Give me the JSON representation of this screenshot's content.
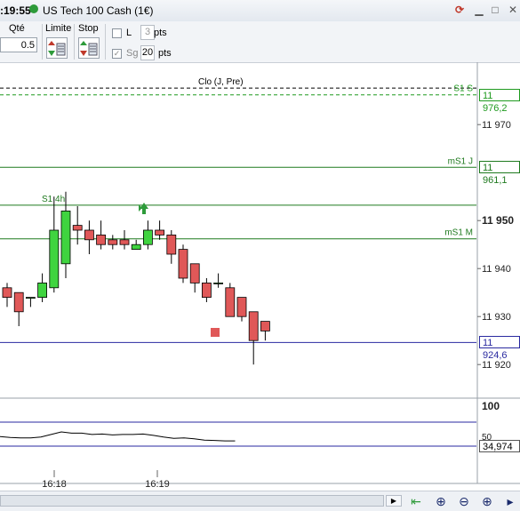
{
  "window": {
    "clock": ":19:55",
    "title": "US Tech 100 Cash (1€)"
  },
  "toolbar": {
    "qty_label": "Qté",
    "qty_value": "0.5",
    "limit_label": "Limite",
    "stop_label": "Stop",
    "l_label": "L",
    "l_value": "3",
    "l_unit": "pts",
    "sg_label": "Sg",
    "sg_value": "20",
    "sg_unit": "pts"
  },
  "chart": {
    "levels": [
      {
        "name": "Clo (J, Pre)",
        "price": 11977.6,
        "tag": "",
        "color": "#000000",
        "dash": true
      },
      {
        "name": "S1 S",
        "price": 11976.2,
        "tag": "11 976,2",
        "color": "#1f9a1f",
        "dash": true
      },
      {
        "name": "mS1 J",
        "price": 11961.1,
        "tag": "11 961,1",
        "color": "#1f7a1f",
        "dash": false
      },
      {
        "name": "S1 4h",
        "price": 11953.2,
        "tag": "",
        "color": "#1f7a1f",
        "dash": false
      },
      {
        "name": "mS1 M",
        "price": 11946.2,
        "tag": "",
        "color": "#1f7a1f",
        "dash": false
      },
      {
        "name": "",
        "price": 11924.6,
        "tag": "11 924,6",
        "color": "#2a2aa0",
        "dash": false
      }
    ],
    "y_ticks": [
      {
        "label": "11 970",
        "price": 11970,
        "bold": false
      },
      {
        "label": "11 950",
        "price": 11950,
        "bold": true
      },
      {
        "label": "11 940",
        "price": 11940,
        "bold": false
      },
      {
        "label": "11 930",
        "price": 11930,
        "bold": false
      },
      {
        "label": "11 920",
        "price": 11920,
        "bold": false
      }
    ],
    "x_ticks": [
      "16:18",
      "16:19"
    ],
    "indicator": {
      "top_label": "100",
      "mid_label": "50",
      "value_tag": "34,974"
    }
  },
  "chart_data": {
    "type": "candlestick",
    "ylim": [
      11913,
      11983
    ],
    "candles": [
      {
        "o": 11936,
        "h": 11937,
        "l": 11932,
        "c": 11934
      },
      {
        "o": 11935,
        "h": 11935,
        "l": 11928,
        "c": 11931
      },
      {
        "o": 11934,
        "h": 11934,
        "l": 11932,
        "c": 11934
      },
      {
        "o": 11934,
        "h": 11939,
        "l": 11933,
        "c": 11937
      },
      {
        "o": 11936,
        "h": 11955,
        "l": 11935,
        "c": 11948
      },
      {
        "o": 11941,
        "h": 11956,
        "l": 11938,
        "c": 11952
      },
      {
        "o": 11949,
        "h": 11953,
        "l": 11945,
        "c": 11948
      },
      {
        "o": 11948,
        "h": 11950,
        "l": 11943,
        "c": 11946
      },
      {
        "o": 11947,
        "h": 11950,
        "l": 11944,
        "c": 11945
      },
      {
        "o": 11946,
        "h": 11947,
        "l": 11944,
        "c": 11945
      },
      {
        "o": 11946,
        "h": 11948,
        "l": 11944,
        "c": 11945
      },
      {
        "o": 11944,
        "h": 11946,
        "l": 11944,
        "c": 11945
      },
      {
        "o": 11945,
        "h": 11950,
        "l": 11944,
        "c": 11948
      },
      {
        "o": 11948,
        "h": 11950,
        "l": 11946,
        "c": 11947
      },
      {
        "o": 11947,
        "h": 11948,
        "l": 11941,
        "c": 11943
      },
      {
        "o": 11944,
        "h": 11945,
        "l": 11937,
        "c": 11938
      },
      {
        "o": 11941,
        "h": 11941,
        "l": 11935,
        "c": 11937
      },
      {
        "o": 11937,
        "h": 11938,
        "l": 11933,
        "c": 11934
      },
      {
        "o": 11937,
        "h": 11939,
        "l": 11936,
        "c": 11937
      },
      {
        "o": 11936,
        "h": 11937,
        "l": 11932,
        "c": 11930
      },
      {
        "o": 11934,
        "h": 11934,
        "l": 11929,
        "c": 11930
      },
      {
        "o": 11931,
        "h": 11931,
        "l": 11920,
        "c": 11925
      },
      {
        "o": 11929,
        "h": 11929,
        "l": 11925,
        "c": 11927
      }
    ],
    "indicator_series": [
      22,
      20,
      19,
      19,
      21,
      27,
      33,
      30,
      30,
      27,
      28,
      26,
      27,
      27,
      28,
      25,
      21,
      18,
      19,
      17,
      14,
      13,
      12,
      12
    ]
  },
  "colors": {
    "bull": "#3fd43f",
    "bear": "#e05858",
    "pivot_green": "#1f7a1f",
    "last_price": "#2a2aa0"
  },
  "bottombar": {
    "tools": [
      "scroll-left-icon",
      "zoom-fit-icon",
      "zoom-out-icon",
      "zoom-in-icon",
      "overflow-icon"
    ]
  }
}
